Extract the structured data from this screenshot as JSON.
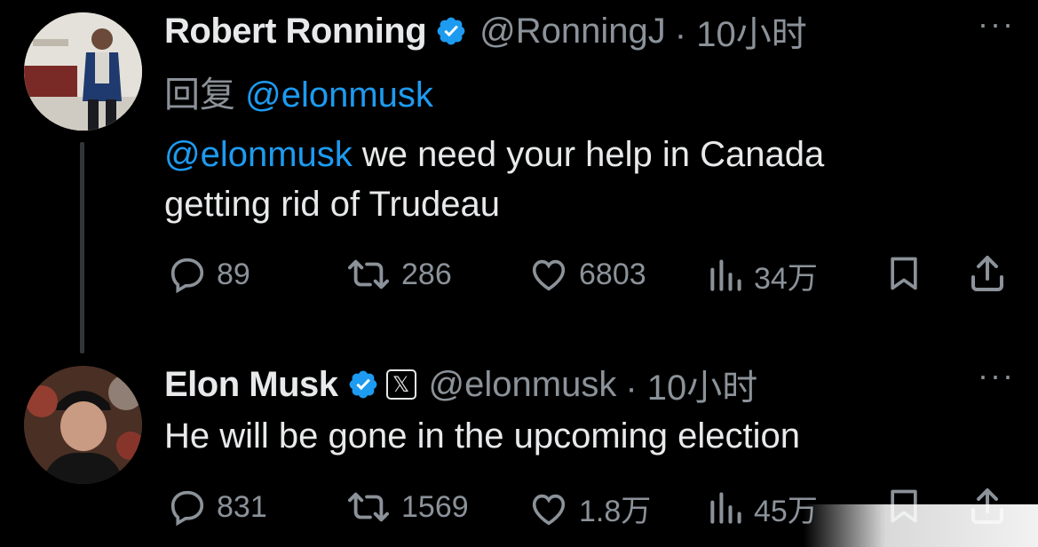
{
  "tweets": [
    {
      "author_name": "Robert Ronning",
      "author_handle": "@RonningJ",
      "time": "· 10小时",
      "more": "···",
      "reply_prefix": "回复",
      "reply_target": "@elonmusk",
      "body_mention": "@elonmusk",
      "body_line1": " we need your help in Canada",
      "body_line2": "getting rid of Trudeau",
      "replies": "89",
      "reposts": "286",
      "likes": "6803",
      "views": "34万"
    },
    {
      "author_name": "Elon Musk",
      "author_handle": "@elonmusk",
      "time": "· 10小时",
      "more": "···",
      "badge_glyph": "𝕏",
      "body_line1": "He will be gone in the upcoming election",
      "replies": "831",
      "reposts": "1569",
      "likes": "1.8万",
      "views": "45万"
    }
  ],
  "colors": {
    "background": "#000000",
    "text": "#e7e9ea",
    "muted": "#8b9299",
    "link": "#1d9bf0",
    "verified": "#1d9bf0"
  }
}
